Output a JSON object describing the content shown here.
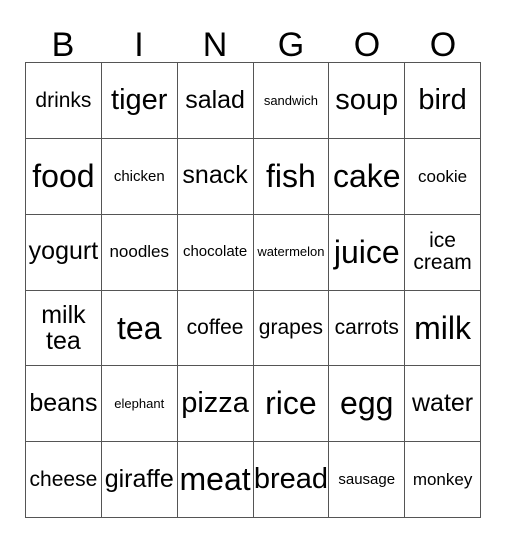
{
  "card": {
    "title": "Bingo Card",
    "header_letters": [
      "B",
      "I",
      "N",
      "G",
      "O",
      "O"
    ],
    "columns": 6,
    "rows": 6,
    "colors": {
      "background": "#ffffff",
      "text": "#000000",
      "grid_line": "#555555"
    },
    "cells": [
      [
        {
          "text": "drinks",
          "size": "sm"
        },
        {
          "text": "tiger",
          "size": "lg"
        },
        {
          "text": "salad",
          "size": "md"
        },
        {
          "text": "sandwich",
          "size": "tiny"
        },
        {
          "text": "soup",
          "size": "lg"
        },
        {
          "text": "bird",
          "size": "lg"
        }
      ],
      [
        {
          "text": "food",
          "size": "xl"
        },
        {
          "text": "chicken",
          "size": "xxs"
        },
        {
          "text": "snack",
          "size": "md"
        },
        {
          "text": "fish",
          "size": "xl"
        },
        {
          "text": "cake",
          "size": "xl"
        },
        {
          "text": "cookie",
          "size": "xs"
        }
      ],
      [
        {
          "text": "yogurt",
          "size": "md"
        },
        {
          "text": "noodles",
          "size": "xs"
        },
        {
          "text": "chocolate",
          "size": "xxs"
        },
        {
          "text": "watermelon",
          "size": "tiny"
        },
        {
          "text": "juice",
          "size": "xl"
        },
        {
          "text": "ice cream",
          "size": "sm",
          "wrap": true
        }
      ],
      [
        {
          "text": "milk tea",
          "size": "md",
          "wrap": true
        },
        {
          "text": "tea",
          "size": "xl"
        },
        {
          "text": "coffee",
          "size": "sm"
        },
        {
          "text": "grapes",
          "size": "sm"
        },
        {
          "text": "carrots",
          "size": "sm"
        },
        {
          "text": "milk",
          "size": "xl"
        }
      ],
      [
        {
          "text": "beans",
          "size": "md"
        },
        {
          "text": "elephant",
          "size": "tiny"
        },
        {
          "text": "pizza",
          "size": "lg"
        },
        {
          "text": "rice",
          "size": "xl"
        },
        {
          "text": "egg",
          "size": "xl"
        },
        {
          "text": "water",
          "size": "md"
        }
      ],
      [
        {
          "text": "cheese",
          "size": "sm"
        },
        {
          "text": "giraffe",
          "size": "md"
        },
        {
          "text": "meat",
          "size": "xl"
        },
        {
          "text": "bread",
          "size": "lg"
        },
        {
          "text": "sausage",
          "size": "xxs"
        },
        {
          "text": "monkey",
          "size": "xs"
        }
      ]
    ]
  }
}
